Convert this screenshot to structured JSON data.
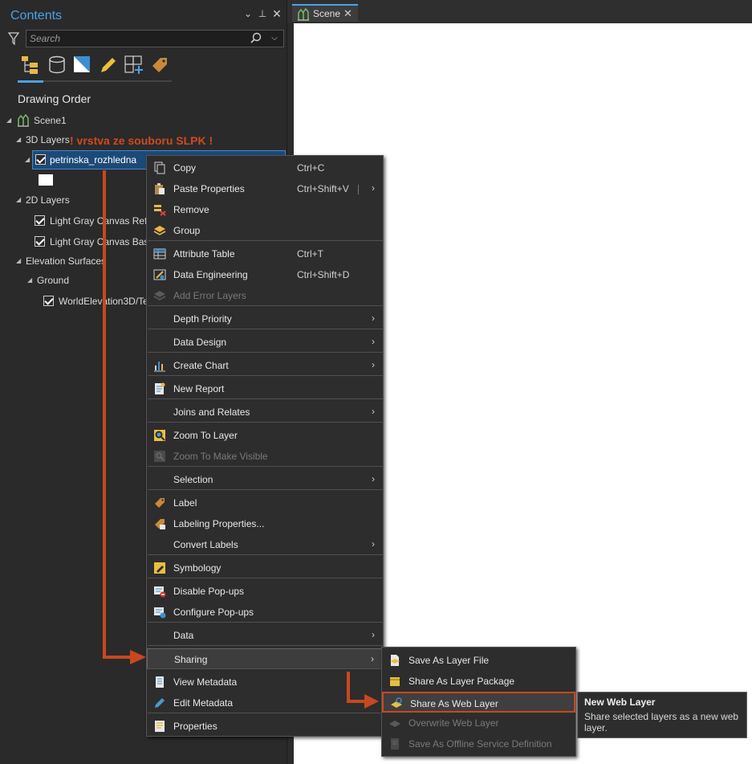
{
  "contents_pane": {
    "title": "Contents",
    "search_placeholder": "Search",
    "heading": "Drawing Order",
    "tree": {
      "scene": "Scene1",
      "group_3d": "3D Layers",
      "layer_selected": "petrinska_rozhledna",
      "group_2d": "2D Layers",
      "layer_2d_1": "Light Gray Canvas Refe",
      "layer_2d_2": "Light Gray Canvas Base",
      "group_elev": "Elevation Surfaces",
      "ground": "Ground",
      "elev_layer": "WorldElevation3D/Te"
    },
    "annotation": "! vrstva ze souboru SLPK !"
  },
  "scene_tab": {
    "label": "Scene"
  },
  "context_menu": {
    "items": [
      {
        "label": "Copy",
        "shortcut": "Ctrl+C"
      },
      {
        "label": "Paste Properties",
        "shortcut": "Ctrl+Shift+V"
      },
      {
        "label": "Remove"
      },
      {
        "label": "Group"
      },
      {
        "label": "Attribute Table",
        "shortcut": "Ctrl+T"
      },
      {
        "label": "Data Engineering",
        "shortcut": "Ctrl+Shift+D"
      },
      {
        "label": "Add Error Layers"
      },
      {
        "label": "Depth Priority"
      },
      {
        "label": "Data Design"
      },
      {
        "label": "Create Chart"
      },
      {
        "label": "New Report"
      },
      {
        "label": "Joins and Relates"
      },
      {
        "label": "Zoom To Layer"
      },
      {
        "label": "Zoom To Make Visible"
      },
      {
        "label": "Selection"
      },
      {
        "label": "Label"
      },
      {
        "label": "Labeling Properties..."
      },
      {
        "label": "Convert Labels"
      },
      {
        "label": "Symbology"
      },
      {
        "label": "Disable Pop-ups"
      },
      {
        "label": "Configure Pop-ups"
      },
      {
        "label": "Data"
      },
      {
        "label": "Sharing"
      },
      {
        "label": "View Metadata"
      },
      {
        "label": "Edit Metadata"
      },
      {
        "label": "Properties"
      }
    ]
  },
  "sharing_submenu": {
    "items": [
      {
        "label": "Save As Layer File"
      },
      {
        "label": "Share As Layer Package"
      },
      {
        "label": "Share As Web Layer"
      },
      {
        "label": "Overwrite Web Layer"
      },
      {
        "label": "Save As Offline Service Definition"
      }
    ]
  },
  "tooltip": {
    "title": "New Web Layer",
    "body": "Share selected layers as a new web layer."
  },
  "colors": {
    "accent": "#4aa3e8",
    "annotation": "#d14a1e",
    "selection": "#1c4a78"
  }
}
